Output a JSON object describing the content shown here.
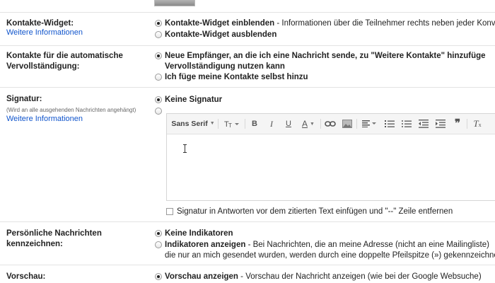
{
  "contacts_widget": {
    "label": "Kontakte-Widget:",
    "more_link": "Weitere Informationen",
    "option_show_bold": "Kontakte-Widget einblenden",
    "option_show_desc": " - Informationen über die Teilnehmer rechts neben jeder Konve",
    "option_hide": "Kontakte-Widget ausblenden"
  },
  "autocomplete": {
    "label_line1": "Kontakte für die automatische",
    "label_line2": "Vervollständigung:",
    "option_auto_line1": "Neue Empfänger, an die ich eine Nachricht sende, zu \"Weitere Kontakte\" hinzufüge",
    "option_auto_line2": "Vervollständigung nutzen kann",
    "option_manual": "Ich füge meine Kontakte selbst hinzu"
  },
  "signature": {
    "label": "Signatur:",
    "sublabel": "(Wird an alle ausgehenden Nachrichten angehängt)",
    "more_link": "Weitere Informationen",
    "option_none": "Keine Signatur",
    "toolbar": {
      "font": "Sans Serif",
      "size_icon": "font-size-icon",
      "bold": "B",
      "italic": "I",
      "underline": "U",
      "text_color": "A",
      "link_icon": "link-icon",
      "image_icon": "image-icon",
      "align_icon": "align-icon",
      "numbered_list_icon": "numbered-list-icon",
      "bullet_list_icon": "bullet-list-icon",
      "indent_less_icon": "indent-less-icon",
      "indent_more_icon": "indent-more-icon",
      "quote_icon": "quote-icon",
      "remove_format_icon": "remove-formatting-icon"
    },
    "insert_before_quote": "Signatur in Antworten vor dem zitierten Text einfügen und \"--\" Zeile entfernen"
  },
  "personal_indicators": {
    "label_line1": "Persönliche Nachrichten",
    "label_line2": "kennzeichnen:",
    "option_none": "Keine Indikatoren",
    "option_show_bold": "Indikatoren anzeigen",
    "option_show_desc": " - Bei Nachrichten, die an meine Adresse (nicht an eine Mailingliste)",
    "option_show_line2": "die nur an mich gesendet wurden, werden durch eine doppelte Pfeilspitze (») gekennzeichnet"
  },
  "preview": {
    "label": "Vorschau:",
    "option_show_bold": "Vorschau anzeigen",
    "option_show_desc": " - Vorschau der Nachricht anzeigen (wie bei der Google Websuche)"
  }
}
